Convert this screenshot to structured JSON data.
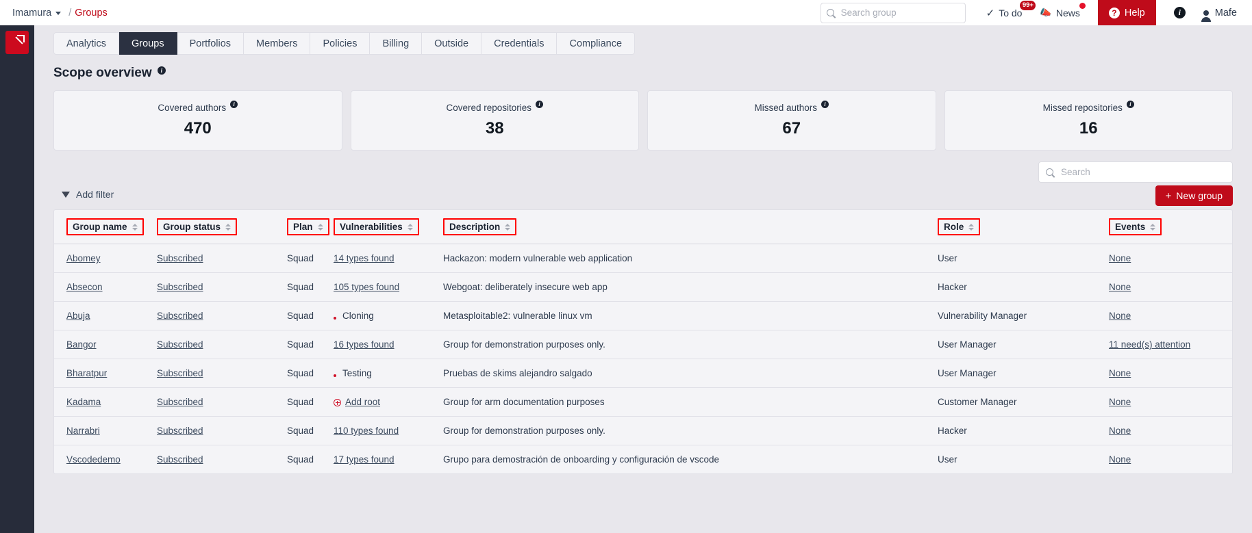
{
  "topbar": {
    "org": "Imamura",
    "separator": "/",
    "current": "Groups",
    "search_placeholder": "Search group",
    "search_value": "",
    "todo_label": "To do",
    "todo_badge": "99+",
    "news_label": "News",
    "help_label": "Help",
    "help_glyph": "?",
    "info_glyph": "i",
    "user_name": "Mafe"
  },
  "tabs": [
    {
      "label": "Analytics",
      "active": false
    },
    {
      "label": "Groups",
      "active": true
    },
    {
      "label": "Portfolios",
      "active": false
    },
    {
      "label": "Members",
      "active": false
    },
    {
      "label": "Policies",
      "active": false
    },
    {
      "label": "Billing",
      "active": false
    },
    {
      "label": "Outside",
      "active": false
    },
    {
      "label": "Credentials",
      "active": false
    },
    {
      "label": "Compliance",
      "active": false
    }
  ],
  "section": {
    "title": "Scope overview"
  },
  "cards": [
    {
      "label": "Covered authors",
      "value": "470"
    },
    {
      "label": "Covered repositories",
      "value": "38"
    },
    {
      "label": "Missed authors",
      "value": "67"
    },
    {
      "label": "Missed repositories",
      "value": "16"
    }
  ],
  "toolbar": {
    "search_placeholder": "Search",
    "search_value": "",
    "add_filter_label": "Add filter",
    "new_group_label": "New group",
    "new_group_plus": "+"
  },
  "table": {
    "columns": [
      {
        "label": "Group name"
      },
      {
        "label": "Group status"
      },
      {
        "label": "Plan"
      },
      {
        "label": "Vulnerabilities"
      },
      {
        "label": "Description"
      },
      {
        "label": "Role"
      },
      {
        "label": "Events"
      }
    ],
    "rows": [
      {
        "name": "Abomey",
        "status": "Subscribed",
        "plan": "Squad",
        "vulnerabilities": "14 types found",
        "vuln_icon": "none",
        "vuln_link": true,
        "description": "Hackazon: modern vulnerable web application",
        "role": "User",
        "events": "None",
        "events_link": true
      },
      {
        "name": "Absecon",
        "status": "Subscribed",
        "plan": "Squad",
        "vulnerabilities": "105 types found",
        "vuln_icon": "none",
        "vuln_link": true,
        "description": "Webgoat: deliberately insecure web app",
        "role": "Hacker",
        "events": "None",
        "events_link": true
      },
      {
        "name": "Abuja",
        "status": "Subscribed",
        "plan": "Squad",
        "vulnerabilities": "Cloning",
        "vuln_icon": "spinner-dot-icon",
        "vuln_link": false,
        "description": "Metasploitable2: vulnerable linux vm",
        "role": "Vulnerability Manager",
        "events": "None",
        "events_link": true
      },
      {
        "name": "Bangor",
        "status": "Subscribed",
        "plan": "Squad",
        "vulnerabilities": "16 types found",
        "vuln_icon": "none",
        "vuln_link": true,
        "description": "Group for demonstration purposes only.",
        "role": "User Manager",
        "events": "11 need(s) attention",
        "events_link": true
      },
      {
        "name": "Bharatpur",
        "status": "Subscribed",
        "plan": "Squad",
        "vulnerabilities": "Testing",
        "vuln_icon": "spinner-dot-icon",
        "vuln_link": false,
        "description": "Pruebas de skims alejandro salgado",
        "role": "User Manager",
        "events": "None",
        "events_link": true
      },
      {
        "name": "Kadama",
        "status": "Subscribed",
        "plan": "Squad",
        "vulnerabilities": "Add root",
        "vuln_icon": "circle-plus-icon",
        "vuln_link": true,
        "description": "Group for arm documentation purposes",
        "role": "Customer Manager",
        "events": "None",
        "events_link": true
      },
      {
        "name": "Narrabri",
        "status": "Subscribed",
        "plan": "Squad",
        "vulnerabilities": "110 types found",
        "vuln_icon": "none",
        "vuln_link": true,
        "description": "Group for demonstration purposes only.",
        "role": "Hacker",
        "events": "None",
        "events_link": true
      },
      {
        "name": "Vscodedemo",
        "status": "Subscribed",
        "plan": "Squad",
        "vulnerabilities": "17 types found",
        "vuln_icon": "none",
        "vuln_link": true,
        "description": "Grupo para demostración de onboarding y configuración de vscode",
        "role": "User",
        "events": "None",
        "events_link": true
      }
    ]
  },
  "colors": {
    "brand_red": "#bf0b1a",
    "sidebar_dark": "#272c3a",
    "page_bg": "#e8e7ec",
    "annotation_red": "#ff0000"
  }
}
